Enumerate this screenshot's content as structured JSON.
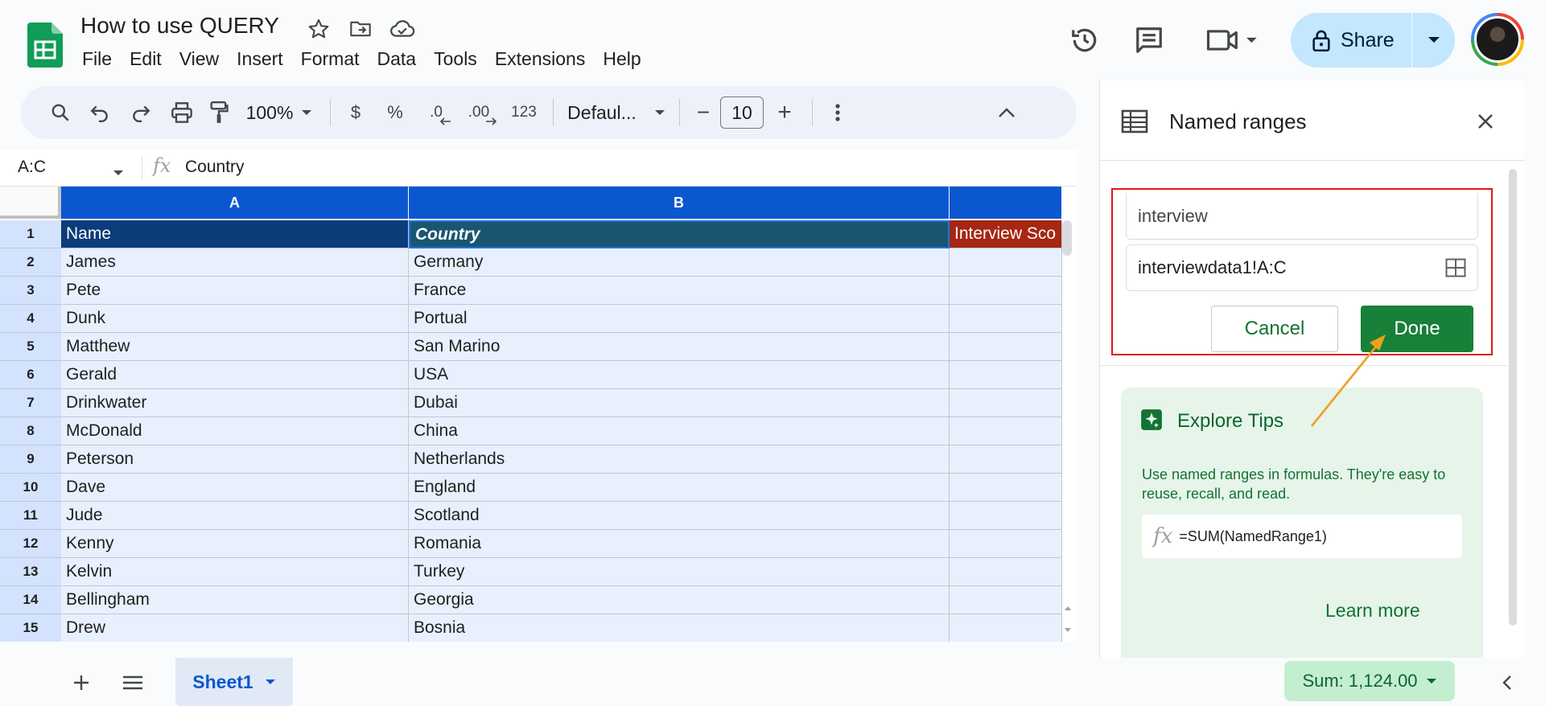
{
  "doc": {
    "title": "How to use QUERY",
    "menu": [
      "File",
      "Edit",
      "View",
      "Insert",
      "Format",
      "Data",
      "Tools",
      "Extensions",
      "Help"
    ]
  },
  "top_actions": {
    "share_label": "Share"
  },
  "toolbar": {
    "zoom": "100%",
    "currency": "$",
    "percent": "%",
    "decrease_decimal": ".0",
    "increase_decimal": ".00",
    "number_format": "123",
    "font": "Defaul...",
    "font_size": "10",
    "minus": "−",
    "plus": "+"
  },
  "formula_bar": {
    "name_box": "A:C",
    "content": "Country"
  },
  "grid": {
    "columns": [
      "A",
      "B",
      ""
    ],
    "rows": [
      {
        "num": "1",
        "a": "Name",
        "b": "Country",
        "c": "Interview Sco"
      },
      {
        "num": "2",
        "a": "James",
        "b": "Germany",
        "c": ""
      },
      {
        "num": "3",
        "a": "Pete",
        "b": "France",
        "c": ""
      },
      {
        "num": "4",
        "a": "Dunk",
        "b": "Portual",
        "c": ""
      },
      {
        "num": "5",
        "a": "Matthew",
        "b": "San Marino",
        "c": ""
      },
      {
        "num": "6",
        "a": "Gerald",
        "b": "USA",
        "c": ""
      },
      {
        "num": "7",
        "a": "Drinkwater",
        "b": "Dubai",
        "c": ""
      },
      {
        "num": "8",
        "a": "McDonald",
        "b": "China",
        "c": ""
      },
      {
        "num": "9",
        "a": "Peterson",
        "b": "Netherlands",
        "c": ""
      },
      {
        "num": "10",
        "a": "Dave",
        "b": "England",
        "c": ""
      },
      {
        "num": "11",
        "a": "Jude",
        "b": "Scotland",
        "c": ""
      },
      {
        "num": "12",
        "a": "Kenny",
        "b": "Romania",
        "c": ""
      },
      {
        "num": "13",
        "a": "Kelvin",
        "b": "Turkey",
        "c": ""
      },
      {
        "num": "14",
        "a": "Bellingham",
        "b": "Georgia",
        "c": ""
      },
      {
        "num": "15",
        "a": "Drew",
        "b": "Bosnia",
        "c": ""
      }
    ]
  },
  "bottom": {
    "sheet_tab": "Sheet1",
    "sum": "Sum: 1,124.00"
  },
  "panel": {
    "title": "Named ranges",
    "name_value": "interview",
    "range_value": "interviewdata1!A:C",
    "cancel_label": "Cancel",
    "done_label": "Done",
    "tips_title": "Explore Tips",
    "tips_text": "Use named ranges in formulas. They're easy to reuse, recall, and read.",
    "tips_formula": "=SUM(NamedRange1)",
    "learn_more": "Learn more"
  },
  "colors": {
    "accent": "#0b57d0",
    "share_bg": "#c2e7ff",
    "done_green": "#188038",
    "highlight_red": "#e0161b",
    "annotation_arrow": "#f0a020"
  }
}
